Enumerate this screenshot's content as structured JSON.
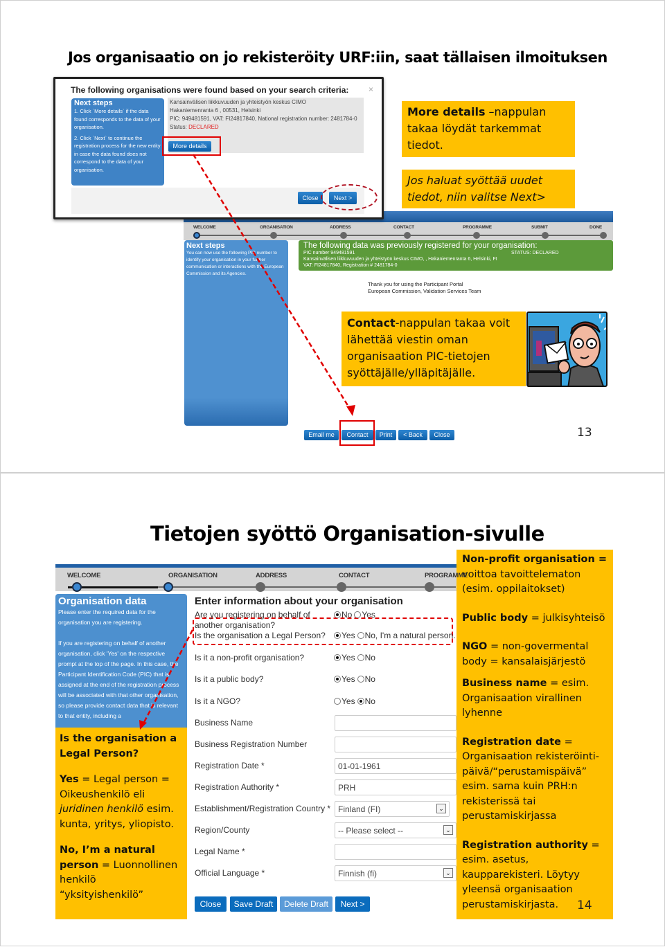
{
  "slide1": {
    "title": "Jos organisaatio on jo rekisteröity URF:iin, saat tällaisen ilmoituksen",
    "page_number": "13",
    "dialog": {
      "heading": "The following organisations were found based on your search criteria:",
      "close_glyph": "×",
      "next_steps_title": "Next steps",
      "next_steps_1": "1. Click `More details` if the data found corresponds to the data of your organisation.",
      "next_steps_2": "2. Click `Next` to continue the registration process for the new entity in case the data found does not correspond to the data of your organisation.",
      "org_name": "Kansainvälisen liikkuvuuden ja yhteistyön keskus CIMO",
      "org_address": "Hakaniemenranta 6 , 00531, Helsinki",
      "org_ids": "PIC: 949481591, VAT: FI24817840, National registration number: 2481784-0",
      "status_label": "Status:",
      "status_value": "DECLARED",
      "more_details_label": "More details",
      "close_label": "Close",
      "next_label": "Next >"
    },
    "callout_more_details": {
      "bold": "More details",
      "text": " –nappulan takaa löydät tarkemmat tiedot."
    },
    "callout_next": "Jos haluat syöttää uudet tiedot, niin valitse Next>",
    "wizard_steps": [
      "WELCOME",
      "ORGANISATION",
      "ADDRESS",
      "CONTACT",
      "PROGRAMME",
      "SUBMIT",
      "DONE"
    ],
    "sidebar": {
      "title": "Next steps",
      "text": "You can now use the following PIC number to identify your organisation in your further communication or interactions with the European Commission and its Agencies."
    },
    "registered": {
      "heading": "The following data was previously registered for your organisation:",
      "pic": "PIC number 949481591",
      "status": "STATUS: DECLARED",
      "address": "Kansainvälisen liikkuvuuden ja yhteistyön keskus CIMO, , Hakaniemenranta 6, Helsinki, FI",
      "vat": "VAT: FI24817840, Registration # 2481784-0"
    },
    "thanks_line1": "Thank you for using the Participant Portal",
    "thanks_line2": "European Commission, Validation Services Team",
    "callout_contact": {
      "bold": "Contact",
      "text": "-nappulan takaa voit lähettää viestin oman organisaation PIC-tietojen syöttäjälle/ylläpitäjälle."
    },
    "bottom_buttons": [
      "Email me",
      "Contact",
      "Print",
      "< Back",
      "Close"
    ]
  },
  "slide2": {
    "title": "Tietojen syöttö Organisation-sivulle",
    "page_number": "14",
    "wizard_steps": [
      "WELCOME",
      "ORGANISATION",
      "ADDRESS",
      "CONTACT",
      "PROGRAMME"
    ],
    "sidebar": {
      "title": "Organisation data",
      "p1": "Please enter the required data for the organisation you are registering.",
      "p2": "If you are registering on behalf of another organisation, click 'Yes' on the respective prompt at the top of the page. In this case, the Participant Identification Code (PIC) that is assigned at the end of the registration process will be associated with that other organisation, so please provide contact data that is relevant to that entity, including a"
    },
    "form": {
      "heading": "Enter information about your organisation",
      "questions": [
        {
          "label": "Are you registering on behalf of another organisation?",
          "options": [
            "No",
            "Yes"
          ],
          "selected": "No"
        },
        {
          "label": "Is the organisation a Legal Person?",
          "options": [
            "Yes",
            "No, I'm a natural person."
          ],
          "selected": "Yes"
        },
        {
          "label": "Is it a non-profit organisation?",
          "options": [
            "Yes",
            "No"
          ],
          "selected": "Yes"
        },
        {
          "label": "Is it a public body?",
          "options": [
            "Yes",
            "No"
          ],
          "selected": "Yes"
        },
        {
          "label": "Is it a NGO?",
          "options": [
            "Yes",
            "No"
          ],
          "selected": "No"
        }
      ],
      "fields": [
        {
          "label": "Business Name",
          "value": ""
        },
        {
          "label": "Business Registration Number",
          "value": ""
        },
        {
          "label": "Registration Date *",
          "value": "01-01-1961"
        },
        {
          "label": "Registration Authority *",
          "value": "PRH"
        },
        {
          "label": "Establishment/Registration Country *",
          "value": "Finland (FI)",
          "type": "select"
        },
        {
          "label": "Region/County",
          "value": "-- Please select --",
          "type": "select"
        },
        {
          "label": "Legal Name *",
          "value": ""
        },
        {
          "label": "Official Language *",
          "value": "Finnish (fi)",
          "type": "select"
        }
      ],
      "buttons": [
        "Close",
        "Save Draft",
        "Delete Draft",
        "Next >"
      ]
    },
    "callout_legal": {
      "q": "Is the organisation a Legal Person?",
      "yes_bold": "Yes",
      "yes_text": " = Legal person = Oikeushenkilö eli ",
      "yes_italic": "juridinen henkilö",
      "yes_tail": " esim. kunta, yritys, yliopisto.",
      "no_bold": "No, I’m a natural person",
      "no_text": " = Luonnollinen henkilö “yksityishenkilö”"
    },
    "callout_right": [
      {
        "bold": "Non-profit organisation =",
        "text": " voittoa tavoittelematon (esim. oppilaitokset)"
      },
      {
        "bold": "Public body",
        "text": " = julkisyhteisö"
      },
      {
        "bold": "NGO",
        "text": " = non-govermental body = kansalaisjärjestö"
      },
      {
        "bold": "Business name",
        "text": " = esim. Organisaation virallinen lyhenne"
      },
      {
        "bold": "Registration date",
        "text": " = Organisaation rekisteröinti-päivä/“perustamispäivä” esim. sama kuin PRH:n rekisterissä tai perustamiskirjassa"
      },
      {
        "bold": "Registration authority",
        "text": " = esim. asetus, kaupparekisteri. Löytyy yleensä organisaation perustamiskirjasta."
      }
    ]
  },
  "colors": {
    "callout_yellow": "#ffc000",
    "portal_blue": "#0b6cbd",
    "sidebar_blue": "#4d90cf",
    "registered_green": "#5c9a3a",
    "annotation_red": "#e00000",
    "status_red": "#e02020"
  }
}
